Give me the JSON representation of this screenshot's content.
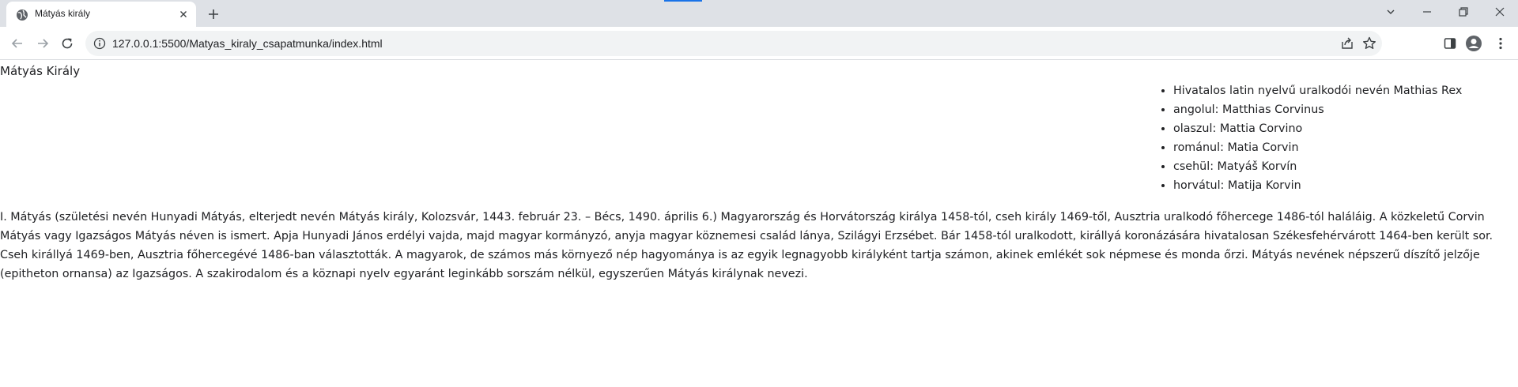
{
  "browser": {
    "tab_title": "Mátyás király",
    "url_host": "127.0.0.1",
    "url_path": ":5500/Matyas_kiraly_csapatmunka/index.html",
    "accent": "#1a73e8"
  },
  "page": {
    "title": "Mátyás Király",
    "names": [
      "Hivatalos latin nyelvű uralkodói nevén Mathias Rex",
      "angolul: Matthias Corvinus",
      "olaszul: Mattia Corvino",
      "románul: Matia Corvin",
      "csehül: Matyáš Korvín",
      "horvátul: Matija Korvin"
    ],
    "bio": "I. Mátyás (születési nevén Hunyadi Mátyás, elterjedt nevén Mátyás király, Kolozsvár, 1443. február 23. – Bécs, 1490. április 6.) Magyarország és Horvátország királya 1458-tól, cseh király 1469-től, Ausztria uralkodó főhercege 1486-tól haláláig. A közkeletű Corvin Mátyás vagy Igazságos Mátyás néven is ismert. Apja Hunyadi János erdélyi vajda, majd magyar kormányzó, anyja magyar köznemesi család lánya, Szilágyi Erzsébet. Bár 1458-tól uralkodott, királlyá koronázására hivatalosan Székesfehérvárott 1464-ben került sor. Cseh királlyá 1469-ben, Ausztria főhercegévé 1486-ban választották. A magyarok, de számos más környező nép hagyománya is az egyik legnagyobb királyként tartja számon, akinek emlékét sok népmese és monda őrzi. Mátyás nevének népszerű díszítő jelzője (epitheton ornansa) az Igazságos. A szakirodalom és a köznapi nyelv egyaránt leginkább sorszám nélkül, egyszerűen Mátyás királynak nevezi."
  }
}
